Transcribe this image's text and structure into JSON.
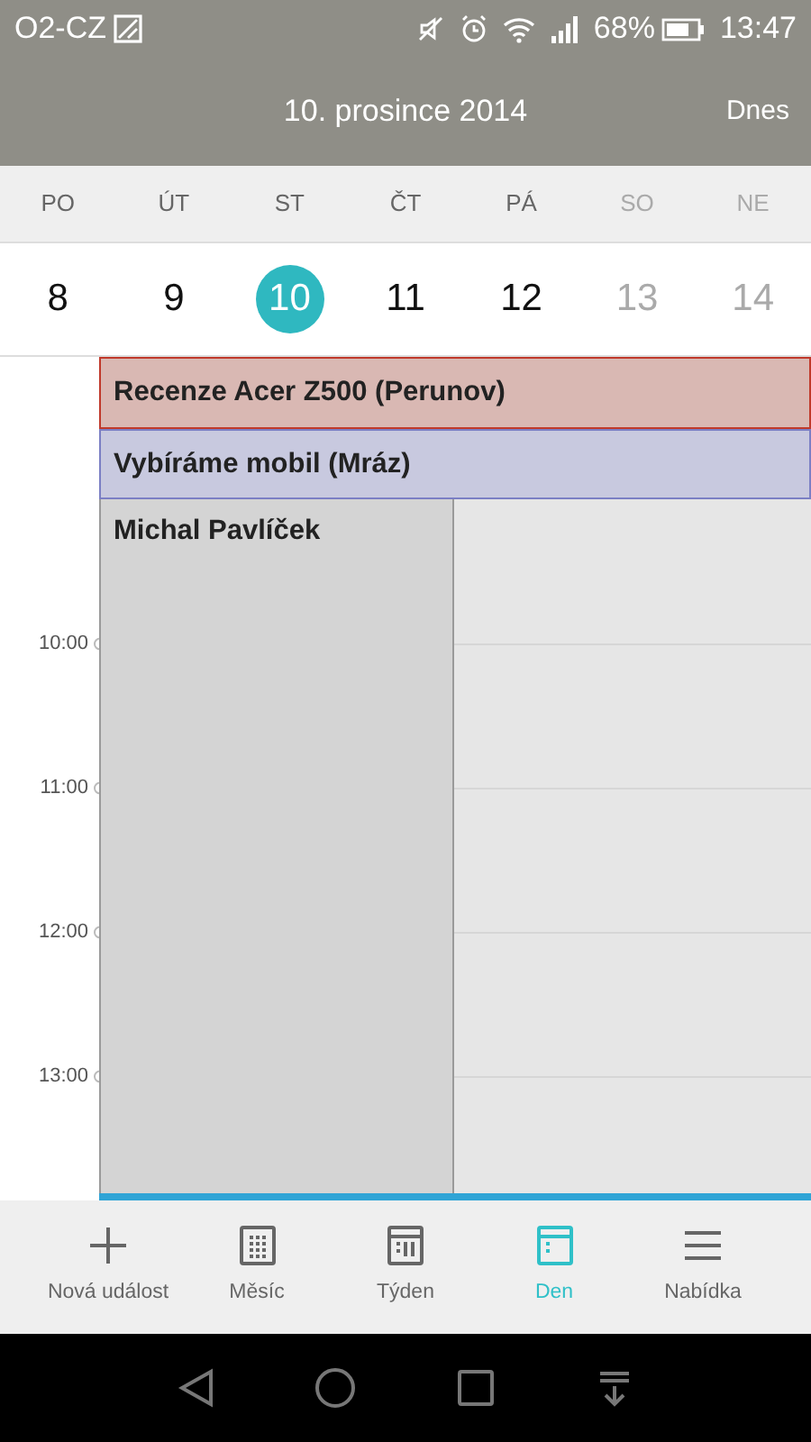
{
  "status_bar": {
    "carrier": "O2-CZ",
    "battery": "68%",
    "time": "13:47"
  },
  "header": {
    "title": "10. prosince 2014",
    "today_button": "Dnes"
  },
  "week": [
    {
      "weekday": "PO",
      "day": "8",
      "selected": false,
      "weekend": false
    },
    {
      "weekday": "ÚT",
      "day": "9",
      "selected": false,
      "weekend": false
    },
    {
      "weekday": "ST",
      "day": "10",
      "selected": true,
      "weekend": false
    },
    {
      "weekday": "ČT",
      "day": "11",
      "selected": false,
      "weekend": false
    },
    {
      "weekday": "PÁ",
      "day": "12",
      "selected": false,
      "weekend": false
    },
    {
      "weekday": "SO",
      "day": "13",
      "selected": false,
      "weekend": true
    },
    {
      "weekday": "NE",
      "day": "14",
      "selected": false,
      "weekend": true
    }
  ],
  "all_day_events": [
    {
      "title": "Recenze Acer Z500 (Perunov)",
      "color": "#d9b8b3"
    },
    {
      "title": "Vybíráme mobil (Mráz)",
      "color": "#c8c9df"
    }
  ],
  "hours": [
    "10:00",
    "11:00",
    "12:00",
    "13:00"
  ],
  "timed_events": [
    {
      "title": "Michal Pavlíček"
    }
  ],
  "bottom_nav": [
    {
      "label": "Nová událost",
      "kind": "plus",
      "selected": false
    },
    {
      "label": "Měsíc",
      "kind": "month",
      "selected": false
    },
    {
      "label": "Týden",
      "kind": "week",
      "selected": false
    },
    {
      "label": "Den",
      "kind": "day",
      "selected": true
    },
    {
      "label": "Nabídka",
      "kind": "menu",
      "selected": false
    }
  ]
}
